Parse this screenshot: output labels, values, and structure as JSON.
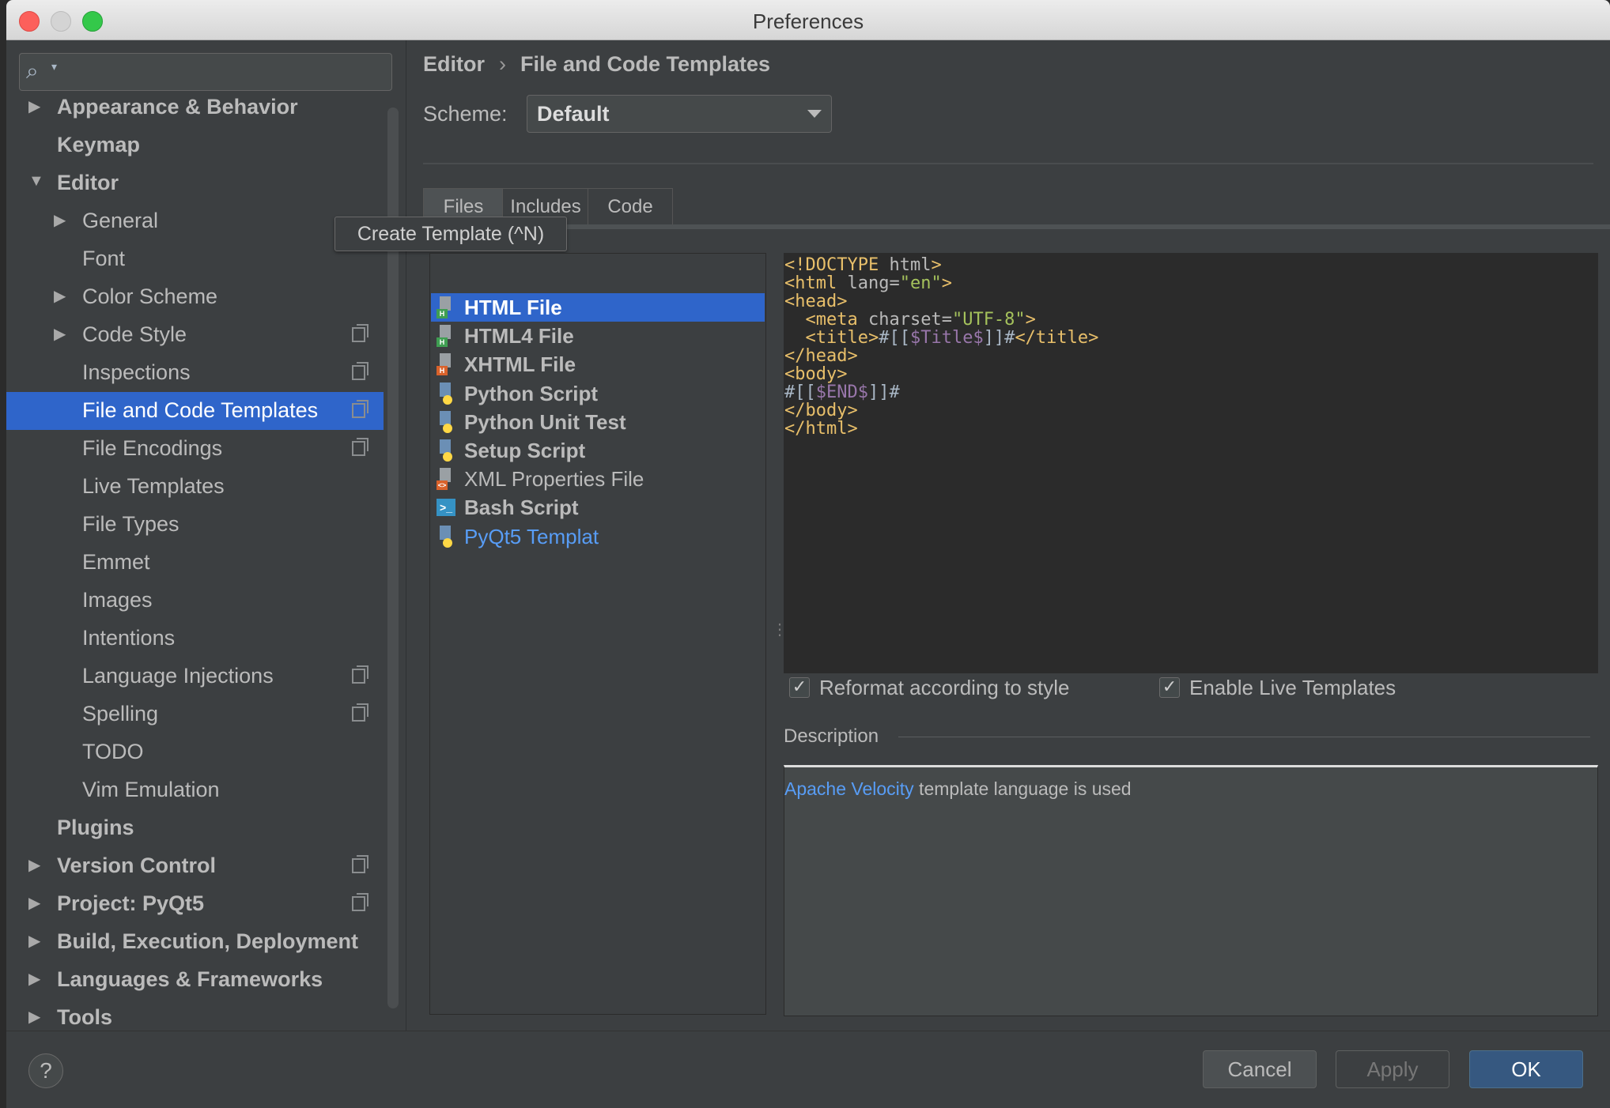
{
  "window": {
    "title": "Preferences"
  },
  "search": {
    "placeholder": ""
  },
  "sidebar": {
    "items": [
      {
        "label": "Appearance & Behavior",
        "level": 0,
        "bold": true,
        "arrow": "collapsed",
        "icon": null
      },
      {
        "label": "Keymap",
        "level": 0,
        "bold": true,
        "arrow": null,
        "icon": null
      },
      {
        "label": "Editor",
        "level": 0,
        "bold": true,
        "arrow": "expanded",
        "icon": null
      },
      {
        "label": "General",
        "level": 1,
        "bold": false,
        "arrow": "collapsed",
        "icon": null
      },
      {
        "label": "Font",
        "level": 1,
        "bold": false,
        "arrow": null,
        "icon": null
      },
      {
        "label": "Color Scheme",
        "level": 1,
        "bold": false,
        "arrow": "collapsed",
        "icon": null
      },
      {
        "label": "Code Style",
        "level": 1,
        "bold": false,
        "arrow": "collapsed",
        "icon": "copy-icon"
      },
      {
        "label": "Inspections",
        "level": 1,
        "bold": false,
        "arrow": null,
        "icon": "copy-icon"
      },
      {
        "label": "File and Code Templates",
        "level": 1,
        "bold": false,
        "arrow": null,
        "icon": "copy-icon",
        "selected": true
      },
      {
        "label": "File Encodings",
        "level": 1,
        "bold": false,
        "arrow": null,
        "icon": "copy-icon"
      },
      {
        "label": "Live Templates",
        "level": 1,
        "bold": false,
        "arrow": null,
        "icon": null
      },
      {
        "label": "File Types",
        "level": 1,
        "bold": false,
        "arrow": null,
        "icon": null
      },
      {
        "label": "Emmet",
        "level": 1,
        "bold": false,
        "arrow": null,
        "icon": null
      },
      {
        "label": "Images",
        "level": 1,
        "bold": false,
        "arrow": null,
        "icon": null
      },
      {
        "label": "Intentions",
        "level": 1,
        "bold": false,
        "arrow": null,
        "icon": null
      },
      {
        "label": "Language Injections",
        "level": 1,
        "bold": false,
        "arrow": null,
        "icon": "copy-icon"
      },
      {
        "label": "Spelling",
        "level": 1,
        "bold": false,
        "arrow": null,
        "icon": "copy-icon"
      },
      {
        "label": "TODO",
        "level": 1,
        "bold": false,
        "arrow": null,
        "icon": null
      },
      {
        "label": "Vim Emulation",
        "level": 1,
        "bold": false,
        "arrow": null,
        "icon": null
      },
      {
        "label": "Plugins",
        "level": 0,
        "bold": true,
        "arrow": null,
        "icon": null
      },
      {
        "label": "Version Control",
        "level": 0,
        "bold": true,
        "arrow": "collapsed",
        "icon": "copy-icon"
      },
      {
        "label": "Project: PyQt5",
        "level": 0,
        "bold": true,
        "arrow": "collapsed",
        "icon": "copy-icon"
      },
      {
        "label": "Build, Execution, Deployment",
        "level": 0,
        "bold": true,
        "arrow": "collapsed",
        "icon": null
      },
      {
        "label": "Languages & Frameworks",
        "level": 0,
        "bold": true,
        "arrow": "collapsed",
        "icon": null
      },
      {
        "label": "Tools",
        "level": 0,
        "bold": true,
        "arrow": "collapsed",
        "icon": null
      }
    ]
  },
  "breadcrumb": {
    "parent": "Editor",
    "separator": "›",
    "current": "File and Code Templates"
  },
  "scheme": {
    "label": "Scheme:",
    "value": "Default"
  },
  "tabs": [
    {
      "label": "Files",
      "active": true
    },
    {
      "label": "Includes",
      "active": false
    },
    {
      "label": "Code",
      "active": false
    }
  ],
  "toolbar": {
    "add": "+",
    "remove": "−",
    "copy": "⧉",
    "reset": "↶"
  },
  "tooltip": {
    "text": "Create Template (^N)"
  },
  "templates": [
    {
      "name": "HTML File",
      "icon": "html-file-icon",
      "bold": true,
      "selected": true,
      "link": false
    },
    {
      "name": "HTML4 File",
      "icon": "html-file-icon",
      "bold": true,
      "selected": false,
      "link": false
    },
    {
      "name": "XHTML File",
      "icon": "xhtml-file-icon",
      "bold": true,
      "selected": false,
      "link": false
    },
    {
      "name": "Python Script",
      "icon": "python-file-icon",
      "bold": true,
      "selected": false,
      "link": false
    },
    {
      "name": "Python Unit Test",
      "icon": "python-file-icon",
      "bold": true,
      "selected": false,
      "link": false
    },
    {
      "name": "Setup Script",
      "icon": "python-file-icon",
      "bold": true,
      "selected": false,
      "link": false
    },
    {
      "name": "XML Properties File",
      "icon": "xml-file-icon",
      "bold": false,
      "selected": false,
      "link": false
    },
    {
      "name": "Bash Script",
      "icon": "bash-file-icon",
      "bold": true,
      "selected": false,
      "link": false
    },
    {
      "name": "PyQt5 Templat",
      "icon": "python-file-icon",
      "bold": false,
      "selected": false,
      "link": true
    }
  ],
  "code": {
    "lines": [
      [
        [
          "tag",
          "<!DOCTYPE "
        ],
        [
          "attr",
          "html"
        ],
        [
          "tag",
          ">"
        ]
      ],
      [
        [
          "tag",
          "<html "
        ],
        [
          "attr",
          "lang="
        ],
        [
          "str",
          "\"en\""
        ],
        [
          "tag",
          ">"
        ]
      ],
      [
        [
          "tag",
          "<head>"
        ]
      ],
      [
        [
          "plain",
          "  "
        ],
        [
          "tag",
          "<meta "
        ],
        [
          "attr",
          "charset="
        ],
        [
          "str",
          "\"UTF-8\""
        ],
        [
          "tag",
          ">"
        ]
      ],
      [
        [
          "plain",
          "  "
        ],
        [
          "tag",
          "<title>"
        ],
        [
          "plain",
          "#[["
        ],
        [
          "var",
          "$Title$"
        ],
        [
          "plain",
          "]]#"
        ],
        [
          "tag",
          "</title>"
        ]
      ],
      [
        [
          "tag",
          "</head>"
        ]
      ],
      [
        [
          "tag",
          "<body>"
        ]
      ],
      [
        [
          "plain",
          "#[["
        ],
        [
          "var",
          "$END$"
        ],
        [
          "plain",
          "]]#"
        ]
      ],
      [
        [
          "tag",
          "</body>"
        ]
      ],
      [
        [
          "tag",
          "</html>"
        ]
      ]
    ]
  },
  "options": {
    "reformat": {
      "label": "Reformat according to style",
      "checked": true
    },
    "live_templates": {
      "label": "Enable Live Templates",
      "checked": true
    }
  },
  "description": {
    "label": "Description",
    "link": "Apache Velocity",
    "text": " template language is used"
  },
  "buttons": {
    "help": "?",
    "cancel": "Cancel",
    "apply": "Apply",
    "ok": "OK"
  },
  "colors": {
    "selection": "#2f65ca",
    "panel": "#3c3f41",
    "editor_bg": "#2b2b2b",
    "link": "#589df6"
  }
}
